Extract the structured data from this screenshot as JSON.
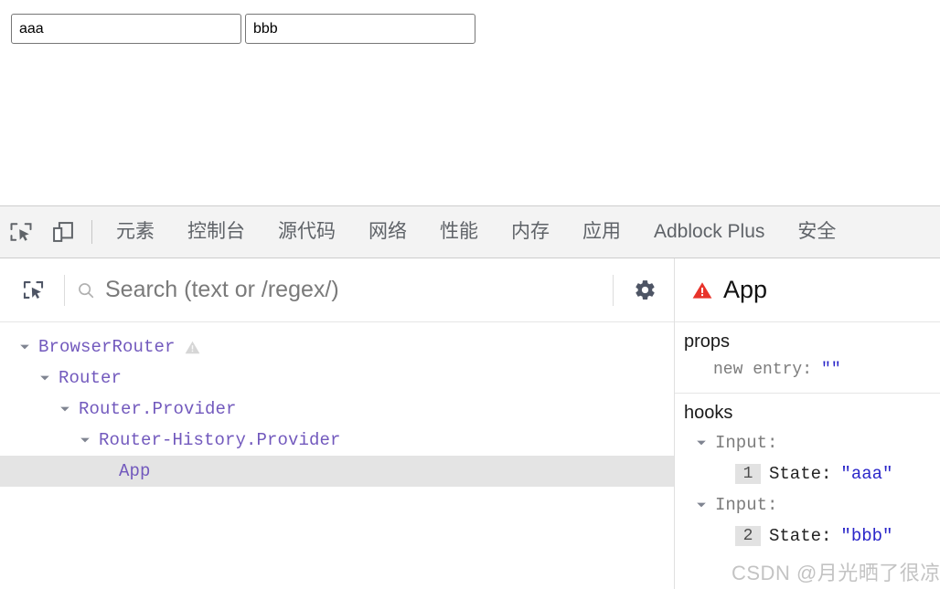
{
  "page": {
    "inputs": [
      {
        "name": "first-input",
        "value": "aaa",
        "placeholder": ""
      },
      {
        "name": "second-input",
        "value": "bbb",
        "placeholder": ""
      }
    ]
  },
  "devtools_toolbar": {
    "icons": [
      {
        "name": "inspect-element-icon"
      },
      {
        "name": "device-toolbar-icon"
      }
    ],
    "tabs": [
      {
        "label": "元素"
      },
      {
        "label": "控制台"
      },
      {
        "label": "源代码"
      },
      {
        "label": "网络"
      },
      {
        "label": "性能"
      },
      {
        "label": "内存"
      },
      {
        "label": "应用"
      },
      {
        "label": "Adblock Plus"
      },
      {
        "label": "安全"
      }
    ]
  },
  "react_devtools": {
    "search": {
      "placeholder": "Search (text or /regex/)",
      "value": ""
    },
    "tree": [
      {
        "label": "BrowserRouter",
        "depth": 0,
        "expanded": true,
        "warning": true,
        "selected": false
      },
      {
        "label": "Router",
        "depth": 1,
        "expanded": true,
        "warning": false,
        "selected": false
      },
      {
        "label": "Router.Provider",
        "depth": 2,
        "expanded": true,
        "warning": false,
        "selected": false
      },
      {
        "label": "Router-History.Provider",
        "depth": 3,
        "expanded": true,
        "warning": false,
        "selected": false
      },
      {
        "label": "App",
        "depth": 4,
        "expanded": false,
        "warning": false,
        "selected": true
      }
    ],
    "inspector": {
      "title": "App",
      "props_section_title": "props",
      "props": [
        {
          "key": "new entry:",
          "value": "\"\""
        }
      ],
      "hooks_section_title": "hooks",
      "hooks": [
        {
          "name": "Input:",
          "expanded": true,
          "index": "1",
          "state_label": "State:",
          "state_value": "\"aaa\""
        },
        {
          "name": "Input:",
          "expanded": true,
          "index": "2",
          "state_label": "State:",
          "state_value": "\"bbb\""
        }
      ]
    }
  },
  "watermark": {
    "text": "CSDN @月光晒了很凉快"
  },
  "colors": {
    "component_purple": "#7259bd",
    "value_blue": "#2a26c9",
    "error_red": "#e02020",
    "toolbar_bg": "#f3f3f3",
    "selected_row": "#e4e4e4"
  }
}
